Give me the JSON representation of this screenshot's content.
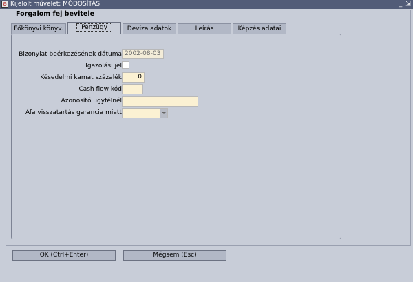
{
  "window": {
    "title": "Kijelölt művelet: MÓDOSÍTÁS",
    "minimize_glyph": "_",
    "maximize_glyph": "⇲",
    "close_glyph": "✕"
  },
  "section": {
    "title": "Forgalom fej bevitele"
  },
  "tabs": [
    {
      "label": "Főkönyvi könyv.",
      "active": false
    },
    {
      "label": "Pénzügy",
      "active": true
    },
    {
      "label": "Deviza adatok",
      "active": false
    },
    {
      "label": "Leírás",
      "active": false
    },
    {
      "label": "Képzés adatai",
      "active": false
    }
  ],
  "form": {
    "receipt_date_label": "Bizonylat beérkezésének dátuma",
    "receipt_date_value": "2002-08-03",
    "certification_label": "Igazolási jel",
    "late_interest_label": "Késedelmi kamat százalék",
    "late_interest_value": "0",
    "cashflow_label": "Cash flow kód",
    "cashflow_value": "",
    "client_id_label": "Azonosító ügyfélnél",
    "client_id_value": "",
    "vat_withholding_label": "Áfa visszatartás garancia miatt",
    "vat_withholding_value": ""
  },
  "buttons": {
    "ok_label": "OK (Ctrl+Enter)",
    "cancel_label": "Mégsem (Esc)"
  }
}
